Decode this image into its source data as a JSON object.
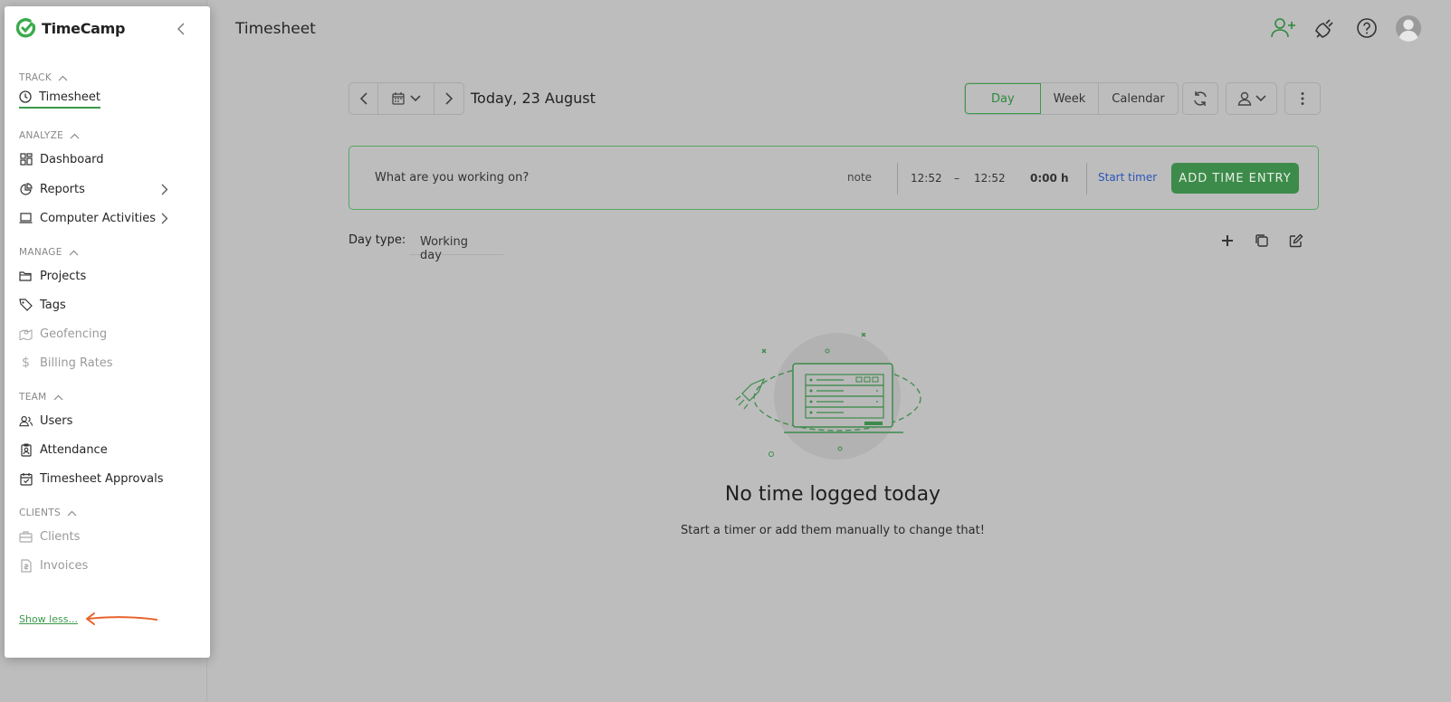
{
  "app": {
    "name": "TimeCamp",
    "brand_color": "#3a9a4a"
  },
  "header": {
    "title": "Timesheet",
    "icons": [
      "add-user-icon",
      "plug-icon",
      "help-icon",
      "avatar"
    ]
  },
  "date_nav": {
    "label": "Today, 23 August"
  },
  "view_tabs": [
    "Day",
    "Week",
    "Calendar"
  ],
  "entry": {
    "placeholder": "What are you working on?",
    "note": "note",
    "start_time": "12:52",
    "dash": "–",
    "end_time": "12:52",
    "duration": "0:00 h",
    "start_timer": "Start timer",
    "add_button": "ADD TIME ENTRY"
  },
  "day_type": {
    "label": "Day type:",
    "value": "Working day"
  },
  "empty_state": {
    "title": "No time logged today",
    "subtitle": "Start a timer or add them manually to change that!"
  },
  "sidebar": {
    "sections": [
      {
        "title": "TRACK",
        "items": [
          {
            "label": "Timesheet"
          }
        ]
      },
      {
        "title": "ANALYZE",
        "items": [
          {
            "label": "Dashboard"
          },
          {
            "label": "Reports"
          },
          {
            "label": "Computer Activities"
          }
        ]
      },
      {
        "title": "MANAGE",
        "items": [
          {
            "label": "Projects"
          },
          {
            "label": "Tags"
          },
          {
            "label": "Geofencing"
          },
          {
            "label": "Billing Rates"
          }
        ]
      },
      {
        "title": "TEAM",
        "items": [
          {
            "label": "Users"
          },
          {
            "label": "Attendance"
          },
          {
            "label": "Timesheet Approvals"
          }
        ]
      },
      {
        "title": "CLIENTS",
        "items": [
          {
            "label": "Clients"
          },
          {
            "label": "Invoices"
          }
        ]
      }
    ],
    "show_less": "Show less..."
  }
}
